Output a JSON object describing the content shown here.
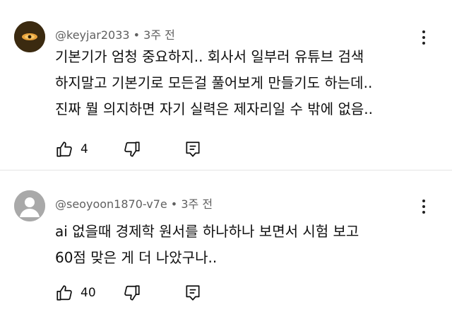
{
  "comments": [
    {
      "author": "@keyjar2033",
      "separator": " • ",
      "time": "3주 전",
      "lines": [
        "기본기가 엄청 중요하지.. 회사서 일부러 유튜브 검색",
        "하지말고 기본기로 모든걸 풀어보게 만들기도 하는데..",
        "진짜 뭘 의지하면 자기 실력은 제자리일 수 밖에 없음.."
      ],
      "likes": "4",
      "avatar_icon": "eye-avatar-icon"
    },
    {
      "author": "@seoyoon1870-v7e",
      "separator": " • ",
      "time": "3주 전",
      "lines": [
        "ai 없을때 경제학 원서를 하나하나 보면서 시험 보고",
        "60점 맞은 게 더 나았구나.."
      ],
      "likes": "40",
      "avatar_icon": "default-user-avatar-icon"
    }
  ],
  "icons": {
    "like": "thumbs-up-icon",
    "dislike": "thumbs-down-icon",
    "reply": "reply-icon",
    "more": "more-vertical-icon"
  },
  "colors": {
    "meta_text": "#606060",
    "body_text": "#0f0f0f",
    "divider": "#e5e5e5"
  }
}
